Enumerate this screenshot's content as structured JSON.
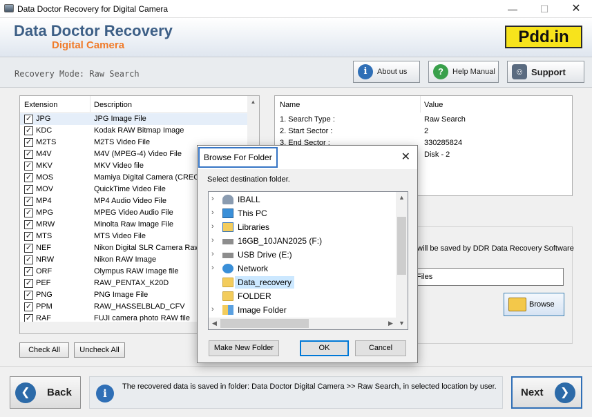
{
  "window": {
    "title": "Data Doctor Recovery for Digital Camera",
    "minimize": "—",
    "maximize": "☐",
    "close": "✕"
  },
  "header": {
    "brand_line1": "Data Doctor Recovery",
    "brand_line2": "Digital Camera",
    "badge": "Pdd.in"
  },
  "mode": {
    "text": "Recovery Mode: Raw Search"
  },
  "top_buttons": {
    "about": "About us",
    "help": "Help Manual",
    "support": "Support"
  },
  "extensions": {
    "col_extension": "Extension",
    "col_description": "Description",
    "rows": [
      {
        "ext": "JPG",
        "desc": "JPG Image File",
        "checked": true
      },
      {
        "ext": "KDC",
        "desc": "Kodak RAW Bitmap Image",
        "checked": true
      },
      {
        "ext": "M2TS",
        "desc": "M2TS Video File",
        "checked": true
      },
      {
        "ext": "M4V",
        "desc": "M4V (MPEG-4) Video File",
        "checked": true
      },
      {
        "ext": "MKV",
        "desc": "MKV Video file",
        "checked": true
      },
      {
        "ext": "MOS",
        "desc": "Mamiya Digital Camera (CREO)F",
        "checked": true
      },
      {
        "ext": "MOV",
        "desc": "QuickTime Video File",
        "checked": true
      },
      {
        "ext": "MP4",
        "desc": "MP4 Audio Video File",
        "checked": true
      },
      {
        "ext": "MPG",
        "desc": "MPEG Video Audio File",
        "checked": true
      },
      {
        "ext": "MRW",
        "desc": "Minolta Raw Image File",
        "checked": true
      },
      {
        "ext": "MTS",
        "desc": "MTS Video File",
        "checked": true
      },
      {
        "ext": "NEF",
        "desc": "Nikon Digital SLR Camera Raw I",
        "checked": true
      },
      {
        "ext": "NRW",
        "desc": "Nikon RAW Image",
        "checked": true
      },
      {
        "ext": "ORF",
        "desc": "Olympus RAW Image file",
        "checked": true
      },
      {
        "ext": "PEF",
        "desc": "RAW_PENTAX_K20D",
        "checked": true
      },
      {
        "ext": "PNG",
        "desc": "PNG Image File",
        "checked": true
      },
      {
        "ext": "PPM",
        "desc": "RAW_HASSELBLAD_CFV",
        "checked": true
      },
      {
        "ext": "RAF",
        "desc": "FUJI camera photo RAW file",
        "checked": true
      }
    ],
    "check_all": "Check All",
    "uncheck_all": "Uncheck All"
  },
  "info": {
    "col_name": "Name",
    "col_value": "Value",
    "rows": [
      {
        "name": "1. Search Type :",
        "value": "Raw Search"
      },
      {
        "name": "2. Start Sector :",
        "value": "2"
      },
      {
        "name": "3. End Sector :",
        "value": "330285824"
      },
      {
        "name": "",
        "value": "Disk - 2"
      }
    ]
  },
  "save": {
    "text": "will be saved by DDR Data Recovery Software",
    "path": "Files",
    "browse": "Browse"
  },
  "footer": {
    "back": "Back",
    "next": "Next",
    "status": "The recovered data is saved in folder: Data Doctor Digital Camera  >> Raw Search, in selected location by user."
  },
  "dialog": {
    "title": "Browse For Folder",
    "close": "✕",
    "instruction": "Select destination folder.",
    "tree": [
      {
        "label": "IBALL",
        "icon": "user-icon",
        "chevron": true,
        "selected": false
      },
      {
        "label": "This PC",
        "icon": "pc-icon",
        "chevron": true,
        "selected": false
      },
      {
        "label": "Libraries",
        "icon": "libraries-icon",
        "chevron": true,
        "selected": false
      },
      {
        "label": "16GB_10JAN2025 (F:)",
        "icon": "drive-icon",
        "chevron": true,
        "selected": false
      },
      {
        "label": "USB Drive (E:)",
        "icon": "drive-icon",
        "chevron": true,
        "selected": false
      },
      {
        "label": "Network",
        "icon": "network-icon",
        "chevron": true,
        "selected": false
      },
      {
        "label": "Data_recovery",
        "icon": "folder-icon",
        "chevron": false,
        "selected": true
      },
      {
        "label": "FOLDER",
        "icon": "folder-icon",
        "chevron": false,
        "selected": false
      },
      {
        "label": "Image Folder",
        "icon": "image-folder-icon",
        "chevron": true,
        "selected": false
      }
    ],
    "new_folder": "Make New Folder",
    "ok": "OK",
    "cancel": "Cancel"
  }
}
